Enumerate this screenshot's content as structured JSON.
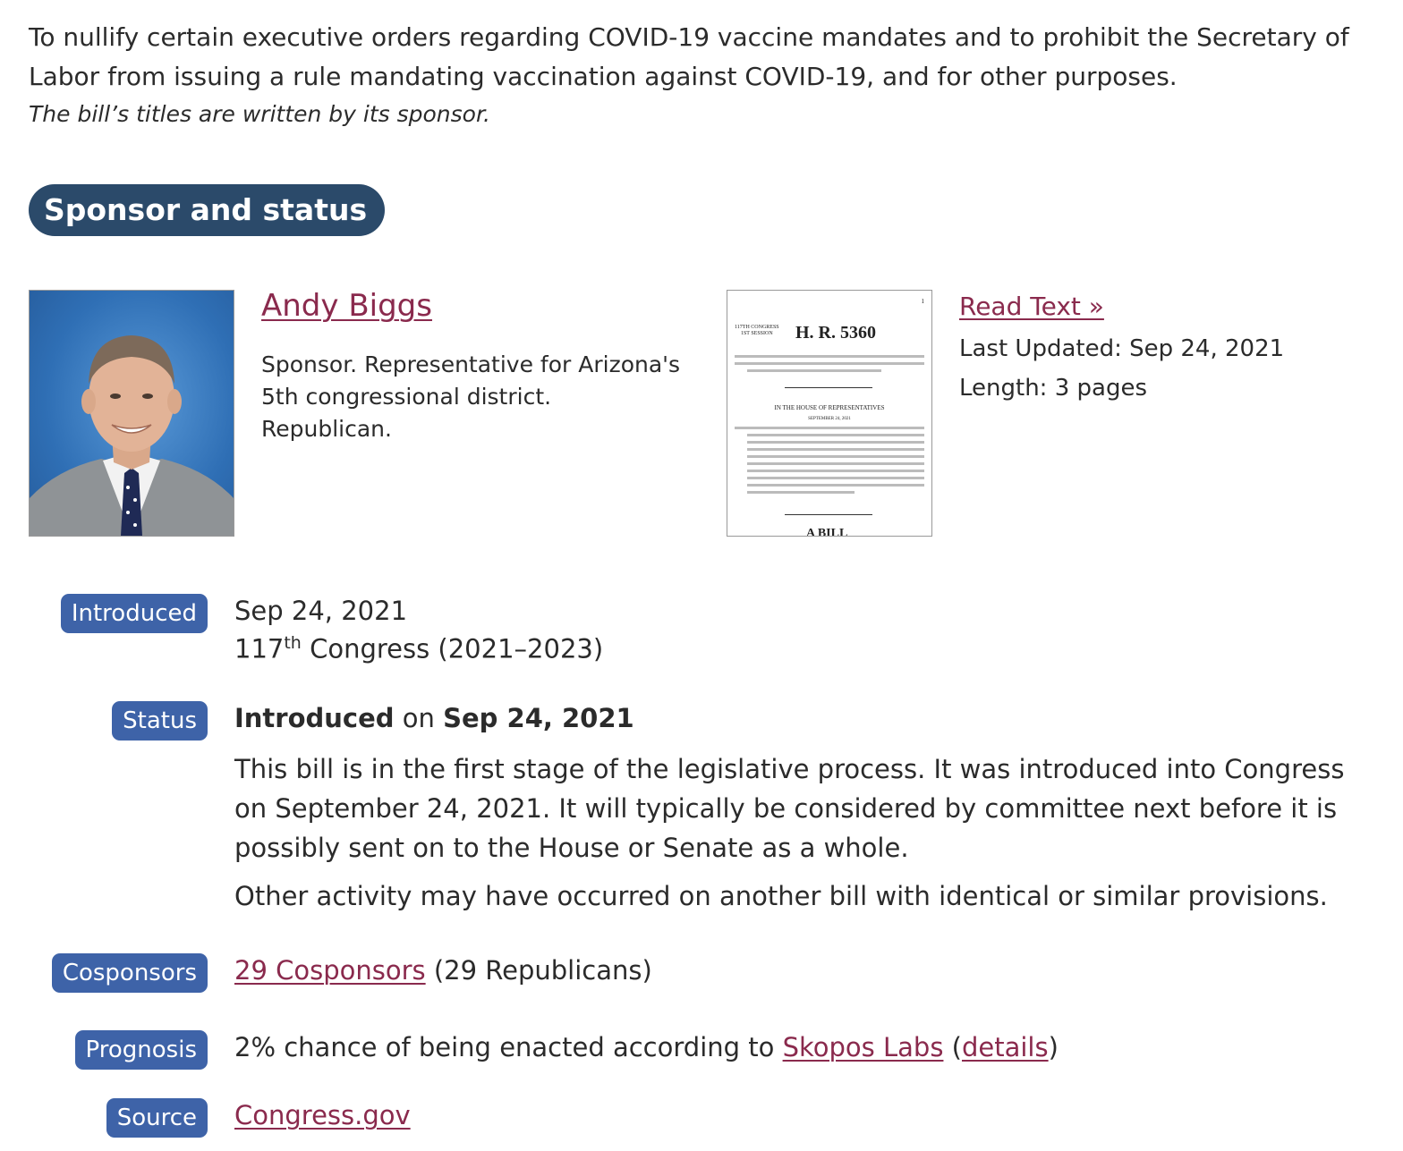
{
  "bill": {
    "title": "To nullify certain executive orders regarding COVID-19 vaccine mandates and to prohibit the Secretary of Labor from issuing a rule mandating vaccination against COVID-19, and for other purposes.",
    "title_note": "The bill’s titles are written by its sponsor."
  },
  "section_header": "Sponsor and status",
  "sponsor": {
    "name": "Andy Biggs",
    "description_lines": [
      "Sponsor. Representative for Arizona's",
      "5th congressional district.",
      "Republican."
    ]
  },
  "document": {
    "page_number": "1",
    "congress_line1": "117TH CONGRESS",
    "congress_line2": "1ST SESSION",
    "bill_number": "H. R. 5360",
    "house_heading": "IN THE HOUSE OF REPRESENTATIVES",
    "house_date": "SEPTEMBER 24, 2021",
    "a_bill": "A BILL",
    "read_text": "Read Text »",
    "last_updated": "Last Updated: Sep 24, 2021",
    "length": "Length: 3 pages"
  },
  "introduced": {
    "label": "Introduced",
    "date": "Sep 24, 2021",
    "congress_number": "117",
    "congress_suffix": "th",
    "congress_rest": " Congress (2021–2023)"
  },
  "status": {
    "label": "Status",
    "stage": "Introduced",
    "on_word": " on ",
    "date": "Sep 24, 2021",
    "description": "This bill is in the first stage of the legislative process. It was introduced into Congress on September 24, 2021. It will typically be considered by committee next before it is possibly sent on to the House or Senate as a whole.",
    "note": "Other activity may have occurred on another bill with identical or similar provisions."
  },
  "cosponsors": {
    "label": "Cosponsors",
    "link": "29 Cosponsors",
    "party_breakdown": " (29 Republicans)"
  },
  "prognosis": {
    "label": "Prognosis",
    "text": "2% chance of being enacted according to ",
    "link": "Skopos Labs",
    "open_paren": " (",
    "details_link": "details",
    "close_paren": ")"
  },
  "source": {
    "label": "Source",
    "link": "Congress.gov"
  },
  "colors": {
    "section_pill": "#2b4a6a",
    "label_pill": "#3e63a8",
    "link": "#8a2a4d"
  }
}
